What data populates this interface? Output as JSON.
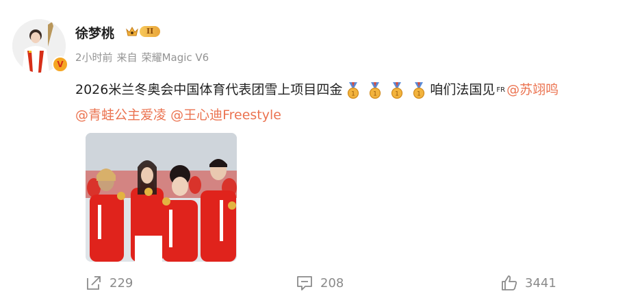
{
  "post": {
    "author": {
      "name": "徐梦桃",
      "verified_mark": "V",
      "level": "II",
      "avatar_icon": "avatar-athlete"
    },
    "meta": {
      "time": "2小时前",
      "source_prefix": "来自",
      "source": "荣耀Magic V6"
    },
    "text": {
      "main": "2026米兰冬奥会中国体育代表团雪上项目四金",
      "medal_icon": "gold-medal-icon",
      "medal_count": 4,
      "after": "咱们法国见",
      "fr": "FR",
      "mentions": [
        "@苏翊鸣",
        "@青蛙公主爱凌",
        "@王心迪Freestyle"
      ]
    },
    "image": {
      "description_icon": "team-photo"
    },
    "actions": {
      "share_count": "229",
      "comment_count": "208",
      "like_count": "3441"
    }
  },
  "colors": {
    "accent": "#eb7350",
    "meta": "#939393",
    "text": "#222222"
  }
}
